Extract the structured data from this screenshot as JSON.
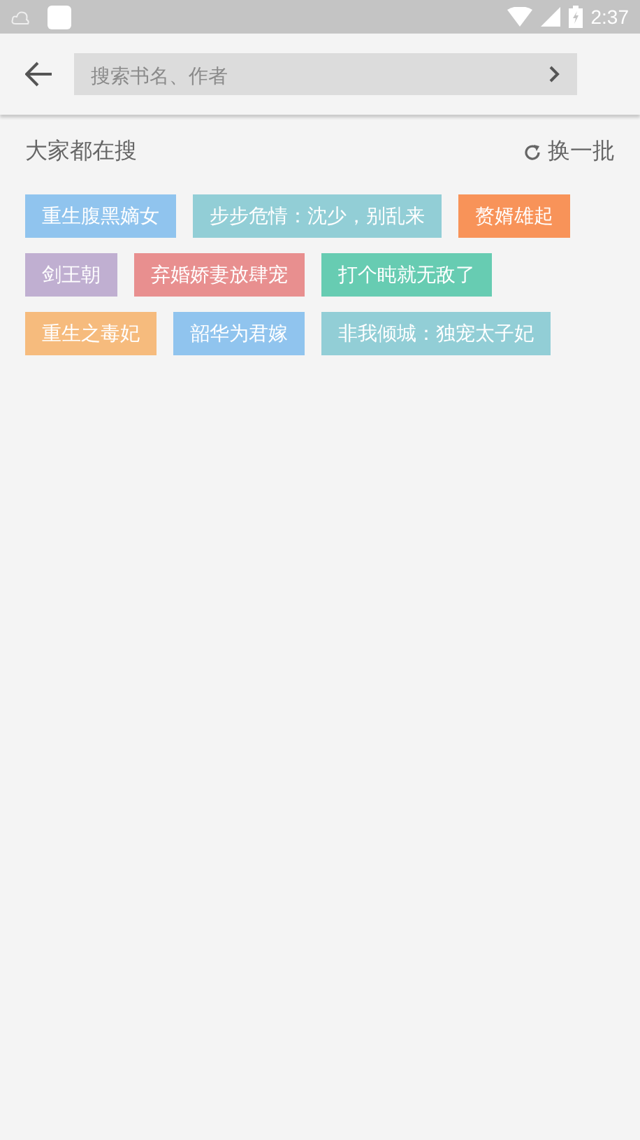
{
  "status_bar": {
    "time": "2:37"
  },
  "search": {
    "placeholder": "搜索书名、作者"
  },
  "section": {
    "title": "大家都在搜",
    "refresh_label": "换一批"
  },
  "tags": [
    {
      "label": "重生腹黑嫡女",
      "color": "#90c4ee"
    },
    {
      "label": "步步危情：沈少，别乱来",
      "color": "#92ced6"
    },
    {
      "label": "赘婿雄起",
      "color": "#f89359"
    },
    {
      "label": "剑王朝",
      "color": "#c0afd1"
    },
    {
      "label": "弃婚娇妻放肆宠",
      "color": "#e88f8f"
    },
    {
      "label": "打个盹就无敌了",
      "color": "#67ccb2"
    },
    {
      "label": "重生之毒妃",
      "color": "#f6bb7d"
    },
    {
      "label": "韶华为君嫁",
      "color": "#90c4ee"
    },
    {
      "label": "非我倾城：独宠太子妃",
      "color": "#92ced6"
    }
  ]
}
